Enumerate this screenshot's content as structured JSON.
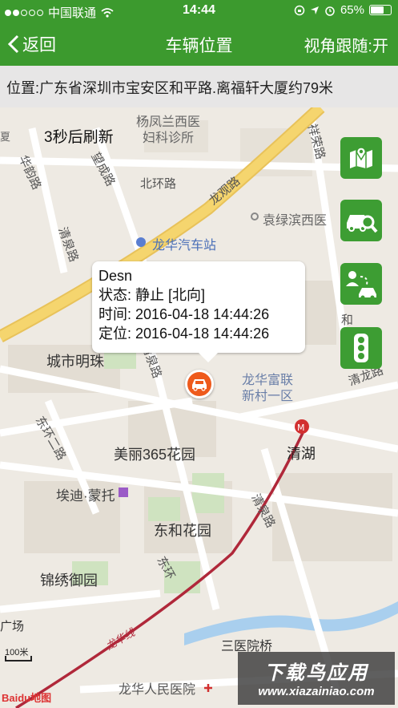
{
  "status_bar": {
    "carrier": "中国联通",
    "time": "14:44",
    "battery_percent": "65%",
    "battery_level": 0.65
  },
  "nav": {
    "back_label": "返回",
    "title": "车辆位置",
    "follow_label": "视角跟随:开"
  },
  "address": "位置:广东省深圳市宝安区和平路.离福轩大厦约79米",
  "refresh_text": "3秒后刷新",
  "popup": {
    "name": "Desn",
    "status": "状态: 静止 [北向]",
    "time": "时间: 2016-04-18 14:44:26",
    "locate": "定位: 2016-04-18 14:44:26"
  },
  "side_buttons": [
    "map-location-icon",
    "car-search-icon",
    "driver-route-icon",
    "traffic-light-icon"
  ],
  "map_labels": {
    "yangfeng": "杨凤兰西医",
    "fuke": "妇科诊所",
    "xiang": "夏",
    "huayun": "华韵路",
    "wangcheng": "望成路",
    "beihuan": "北环路",
    "longguan": "龙观路",
    "xiangrong": "祥荣路",
    "yuanlv": "袁绿滨西医",
    "longhua_bus": "龙华汽车站",
    "qingquan1": "清泉路",
    "chengshi": "城市明珠",
    "qingquan2": "清泉路",
    "longhua_fulian": "龙华富联",
    "xincun": "新村一区",
    "he": "和",
    "qinglong": "清龙路",
    "donghuan1": "东环二路",
    "meili": "美丽365花园",
    "qinghu": "清湖",
    "aidi": "埃迪·蒙托",
    "donghe": "东和花园",
    "qingquan3": "清泉路",
    "donghuan2": "东环",
    "jinxiu": "锦绣御园",
    "guangchang": "广场",
    "sanyi": "三医院桥",
    "longhua_line": "龙华线",
    "renmin": "龙华人民医院"
  },
  "scale_label": "100米",
  "baidu_logo": "Baidu地图",
  "watermark": {
    "title": "下载鸟应用",
    "url": "www.xiazainiao.com"
  },
  "colors": {
    "header_green": "#3c9a2e",
    "button_green": "#3d9d33",
    "marker_orange": "#ee5a1c",
    "main_road": "#f5d56e",
    "metro_line": "#b0283a"
  }
}
